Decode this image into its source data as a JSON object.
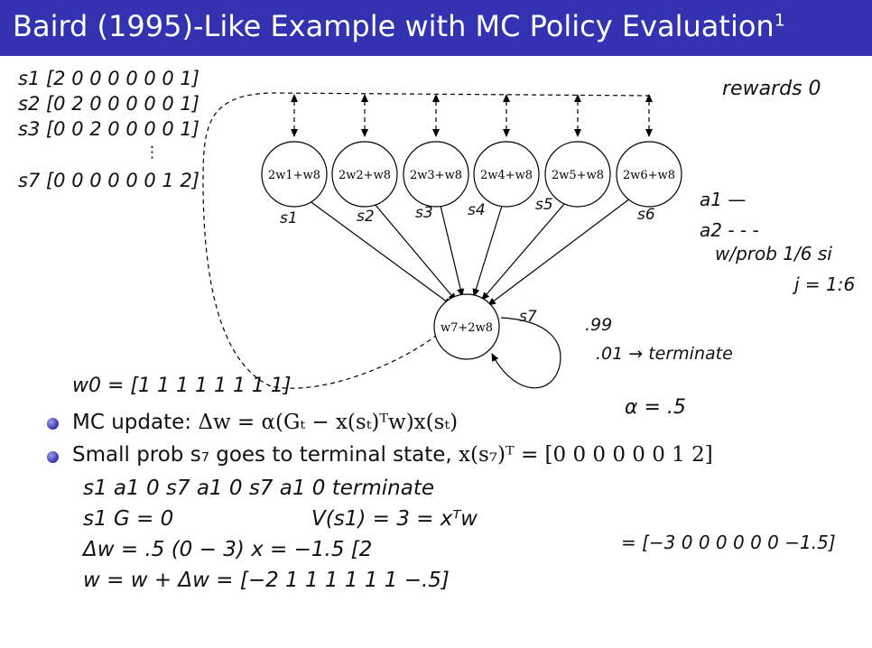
{
  "header": {
    "title": "Baird (1995)-Like Example with MC Policy Evaluation",
    "footnote_mark": "1"
  },
  "diagram": {
    "top_nodes": [
      {
        "label": "2w1+w8",
        "state": "s1"
      },
      {
        "label": "2w2+w8",
        "state": "s2"
      },
      {
        "label": "2w3+w8",
        "state": "s3"
      },
      {
        "label": "2w4+w8",
        "state": "s4"
      },
      {
        "label": "2w5+w8",
        "state": "s5"
      },
      {
        "label": "2w6+w8",
        "state": "s6"
      }
    ],
    "bottom_node": {
      "label": "w7+2w8",
      "state": "s7"
    }
  },
  "handwritten": {
    "feature_s1": "s1 [2 0 0 0 0 0 0 1]",
    "feature_s2": "s2 [0 2 0 0 0 0 0 1]",
    "feature_s3": "s3 [0 0 2 0 0 0 0 1]",
    "feature_dots": "⋮",
    "feature_s7": "s7 [0 0 0 0 0 0 1 2]",
    "w0": "w0 = [1 1 1 1 1 1 1 1]",
    "rewards": "rewards 0",
    "a1": "a1 —",
    "a2": "a2 - - -",
    "wprob": "w/prob 1/6 si",
    "j_range": "j = 1:6",
    "p_stay": ".99",
    "p_term": ".01 → terminate",
    "alpha": "α = .5",
    "episode": "s1  a1  0  s7  a1  0  s7  a1  0  terminate",
    "return_line": "s1   G = 0",
    "value_line": "V(s1) = 3 = xᵀw",
    "delta_line": "Δw = .5 (0 − 3) x = −1.5 [2",
    "update_line": "w = w + Δw = [−2 1 1 1 1 1 1 −.5]",
    "right_vec": "= [−3 0 0 0 0 0 0 −1.5]"
  },
  "bullets": [
    {
      "prefix": "MC update: ",
      "formula": "Δw = α(Gₜ − x(sₜ)ᵀw)x(sₜ)"
    },
    {
      "prefix": "Small prob s₇ goes to terminal state, ",
      "formula": "x(s₇)ᵀ = [0 0 0 0 0 0 1 2]"
    }
  ]
}
